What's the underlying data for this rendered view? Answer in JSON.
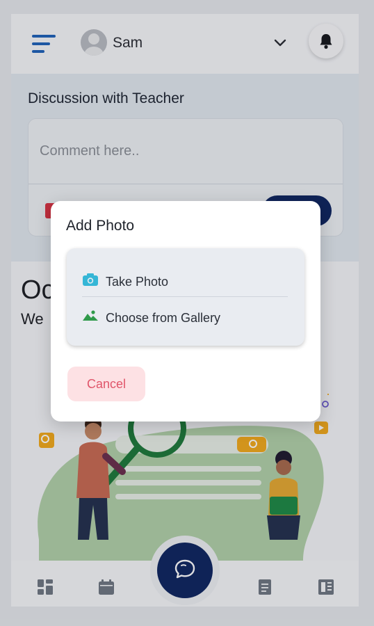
{
  "header": {
    "user_name": "Sam",
    "icons": {
      "menu": "hamburger-menu-icon",
      "avatar": "user-avatar-icon",
      "dropdown": "chevron-down-icon",
      "notifications": "bell-icon"
    }
  },
  "discussion": {
    "title": "Discussion with Teacher",
    "comment_placeholder": "Comment here.."
  },
  "content": {
    "title_partial": "Oc",
    "subtitle_partial": "We"
  },
  "dialog": {
    "title": "Add Photo",
    "options": [
      {
        "label": "Take Photo",
        "icon": "camera-icon"
      },
      {
        "label": "Choose from Gallery",
        "icon": "image-gallery-icon"
      }
    ],
    "cancel_label": "Cancel"
  },
  "bottom_nav": {
    "items": [
      "dashboard-icon",
      "calendar-icon",
      "chat-bubble-icon",
      "report-icon",
      "notebook-icon"
    ]
  },
  "colors": {
    "primary": "#0f2660",
    "accent_blue": "#1f62b8",
    "cancel_bg": "#fde1e4",
    "cancel_text": "#e0556a"
  }
}
